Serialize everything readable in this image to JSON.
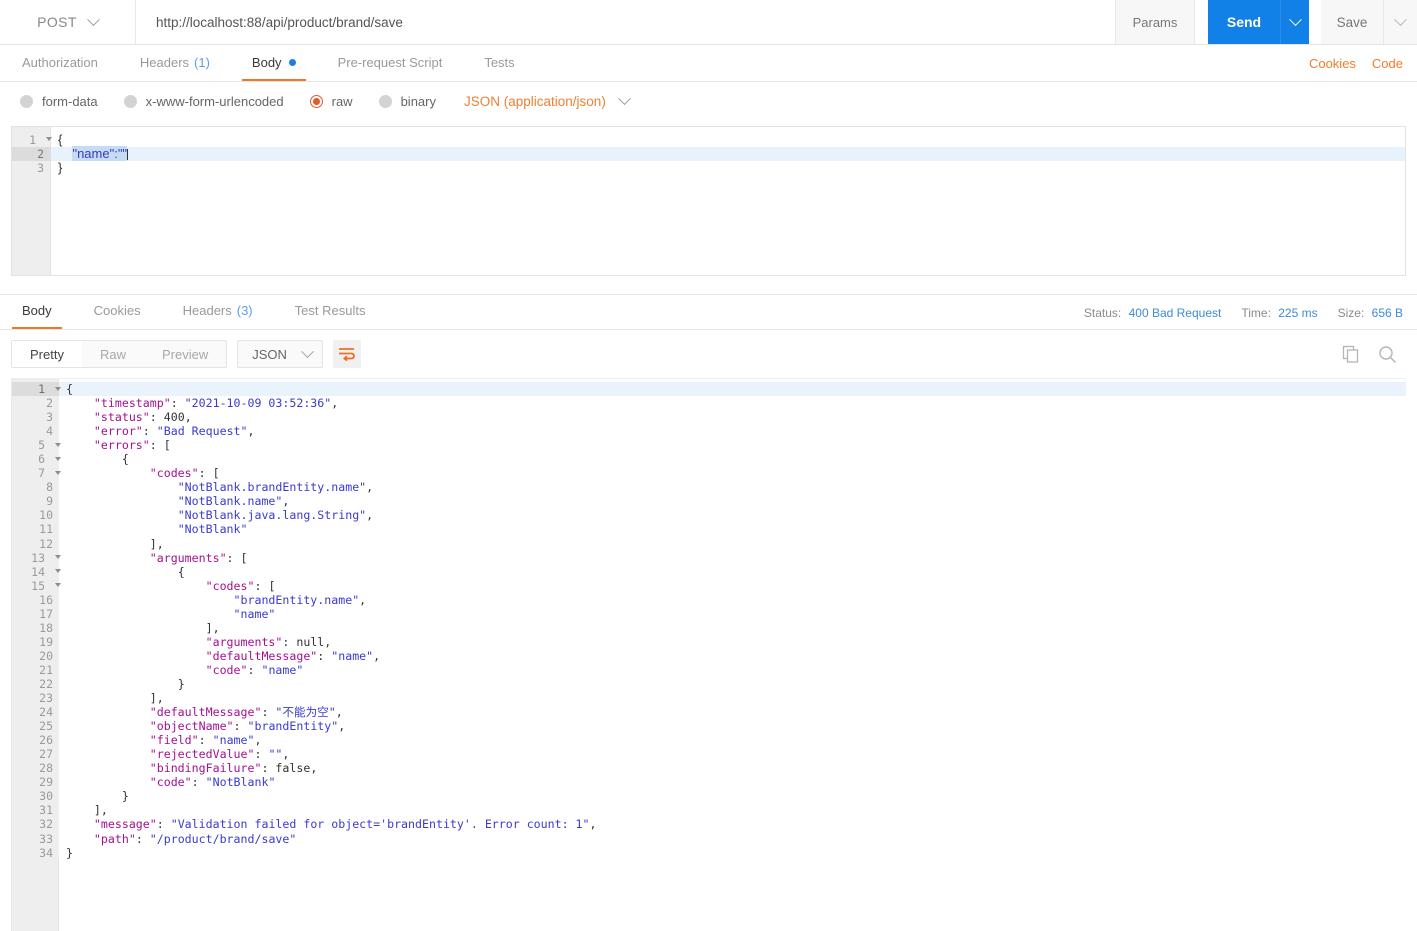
{
  "urlbar": {
    "method": "POST",
    "url": "http://localhost:88/api/product/brand/save",
    "params_label": "Params",
    "send_label": "Send",
    "save_label": "Save"
  },
  "request_tabs": [
    {
      "label": "Authorization",
      "count": "",
      "active": false,
      "dot": false
    },
    {
      "label": "Headers",
      "count": "(1)",
      "active": false,
      "dot": false
    },
    {
      "label": "Body",
      "count": "",
      "active": true,
      "dot": true
    },
    {
      "label": "Pre-request Script",
      "count": "",
      "active": false,
      "dot": false
    },
    {
      "label": "Tests",
      "count": "",
      "active": false,
      "dot": false
    }
  ],
  "tabs_right": {
    "cookies": "Cookies",
    "code": "Code"
  },
  "body_type": {
    "options": [
      {
        "label": "form-data",
        "checked": false
      },
      {
        "label": "x-www-form-urlencoded",
        "checked": false
      },
      {
        "label": "raw",
        "checked": true
      },
      {
        "label": "binary",
        "checked": false
      }
    ],
    "format": "JSON (application/json)"
  },
  "request_body": {
    "lines": [
      {
        "num": "1",
        "fold": true,
        "selected": false,
        "text": "{"
      },
      {
        "num": "2",
        "fold": false,
        "selected": true,
        "text": "    \"name\":\"\""
      },
      {
        "num": "3",
        "fold": false,
        "selected": false,
        "text": "}"
      }
    ],
    "selected_text": "\"name\":\"\""
  },
  "response_tabs": [
    {
      "label": "Body",
      "count": "",
      "active": true
    },
    {
      "label": "Cookies",
      "count": "",
      "active": false
    },
    {
      "label": "Headers",
      "count": "(3)",
      "active": false
    },
    {
      "label": "Test Results",
      "count": "",
      "active": false
    }
  ],
  "response_status": {
    "status_label": "Status:",
    "status_value": "400 Bad Request",
    "time_label": "Time:",
    "time_value": "225 ms",
    "size_label": "Size:",
    "size_value": "656 B"
  },
  "response_toolbar": {
    "views": [
      {
        "label": "Pretty",
        "active": true
      },
      {
        "label": "Raw",
        "active": false
      },
      {
        "label": "Preview",
        "active": false
      }
    ],
    "format": "JSON",
    "wrap_icon": "word-wrap-icon",
    "copy_icon": "copy-icon",
    "search_icon": "search-icon"
  },
  "response_body": {
    "language": "json",
    "lines": [
      {
        "num": "1",
        "fold": true,
        "active": true,
        "indent": 0,
        "tokens": [
          {
            "t": "p",
            "v": "{"
          }
        ]
      },
      {
        "num": "2",
        "fold": false,
        "active": false,
        "indent": 1,
        "tokens": [
          {
            "t": "k",
            "v": "\"timestamp\""
          },
          {
            "t": "p",
            "v": ": "
          },
          {
            "t": "s",
            "v": "\"2021-10-09 03:52:36\""
          },
          {
            "t": "p",
            "v": ","
          }
        ]
      },
      {
        "num": "3",
        "fold": false,
        "active": false,
        "indent": 1,
        "tokens": [
          {
            "t": "k",
            "v": "\"status\""
          },
          {
            "t": "p",
            "v": ": "
          },
          {
            "t": "n",
            "v": "400"
          },
          {
            "t": "p",
            "v": ","
          }
        ]
      },
      {
        "num": "4",
        "fold": false,
        "active": false,
        "indent": 1,
        "tokens": [
          {
            "t": "k",
            "v": "\"error\""
          },
          {
            "t": "p",
            "v": ": "
          },
          {
            "t": "s",
            "v": "\"Bad Request\""
          },
          {
            "t": "p",
            "v": ","
          }
        ]
      },
      {
        "num": "5",
        "fold": true,
        "active": false,
        "indent": 1,
        "tokens": [
          {
            "t": "k",
            "v": "\"errors\""
          },
          {
            "t": "p",
            "v": ": ["
          }
        ]
      },
      {
        "num": "6",
        "fold": true,
        "active": false,
        "indent": 2,
        "tokens": [
          {
            "t": "p",
            "v": "{"
          }
        ]
      },
      {
        "num": "7",
        "fold": true,
        "active": false,
        "indent": 3,
        "tokens": [
          {
            "t": "k",
            "v": "\"codes\""
          },
          {
            "t": "p",
            "v": ": ["
          }
        ]
      },
      {
        "num": "8",
        "fold": false,
        "active": false,
        "indent": 4,
        "tokens": [
          {
            "t": "s",
            "v": "\"NotBlank.brandEntity.name\""
          },
          {
            "t": "p",
            "v": ","
          }
        ]
      },
      {
        "num": "9",
        "fold": false,
        "active": false,
        "indent": 4,
        "tokens": [
          {
            "t": "s",
            "v": "\"NotBlank.name\""
          },
          {
            "t": "p",
            "v": ","
          }
        ]
      },
      {
        "num": "10",
        "fold": false,
        "active": false,
        "indent": 4,
        "tokens": [
          {
            "t": "s",
            "v": "\"NotBlank.java.lang.String\""
          },
          {
            "t": "p",
            "v": ","
          }
        ]
      },
      {
        "num": "11",
        "fold": false,
        "active": false,
        "indent": 4,
        "tokens": [
          {
            "t": "s",
            "v": "\"NotBlank\""
          }
        ]
      },
      {
        "num": "12",
        "fold": false,
        "active": false,
        "indent": 3,
        "tokens": [
          {
            "t": "p",
            "v": "],"
          }
        ]
      },
      {
        "num": "13",
        "fold": true,
        "active": false,
        "indent": 3,
        "tokens": [
          {
            "t": "k",
            "v": "\"arguments\""
          },
          {
            "t": "p",
            "v": ": ["
          }
        ]
      },
      {
        "num": "14",
        "fold": true,
        "active": false,
        "indent": 4,
        "tokens": [
          {
            "t": "p",
            "v": "{"
          }
        ]
      },
      {
        "num": "15",
        "fold": true,
        "active": false,
        "indent": 5,
        "tokens": [
          {
            "t": "k",
            "v": "\"codes\""
          },
          {
            "t": "p",
            "v": ": ["
          }
        ]
      },
      {
        "num": "16",
        "fold": false,
        "active": false,
        "indent": 6,
        "tokens": [
          {
            "t": "s",
            "v": "\"brandEntity.name\""
          },
          {
            "t": "p",
            "v": ","
          }
        ]
      },
      {
        "num": "17",
        "fold": false,
        "active": false,
        "indent": 6,
        "tokens": [
          {
            "t": "s",
            "v": "\"name\""
          }
        ]
      },
      {
        "num": "18",
        "fold": false,
        "active": false,
        "indent": 5,
        "tokens": [
          {
            "t": "p",
            "v": "],"
          }
        ]
      },
      {
        "num": "19",
        "fold": false,
        "active": false,
        "indent": 5,
        "tokens": [
          {
            "t": "k",
            "v": "\"arguments\""
          },
          {
            "t": "p",
            "v": ": "
          },
          {
            "t": "n",
            "v": "null"
          },
          {
            "t": "p",
            "v": ","
          }
        ]
      },
      {
        "num": "20",
        "fold": false,
        "active": false,
        "indent": 5,
        "tokens": [
          {
            "t": "k",
            "v": "\"defaultMessage\""
          },
          {
            "t": "p",
            "v": ": "
          },
          {
            "t": "s",
            "v": "\"name\""
          },
          {
            "t": "p",
            "v": ","
          }
        ]
      },
      {
        "num": "21",
        "fold": false,
        "active": false,
        "indent": 5,
        "tokens": [
          {
            "t": "k",
            "v": "\"code\""
          },
          {
            "t": "p",
            "v": ": "
          },
          {
            "t": "s",
            "v": "\"name\""
          }
        ]
      },
      {
        "num": "22",
        "fold": false,
        "active": false,
        "indent": 4,
        "tokens": [
          {
            "t": "p",
            "v": "}"
          }
        ]
      },
      {
        "num": "23",
        "fold": false,
        "active": false,
        "indent": 3,
        "tokens": [
          {
            "t": "p",
            "v": "],"
          }
        ]
      },
      {
        "num": "24",
        "fold": false,
        "active": false,
        "indent": 3,
        "tokens": [
          {
            "t": "k",
            "v": "\"defaultMessage\""
          },
          {
            "t": "p",
            "v": ": "
          },
          {
            "t": "s",
            "v": "\"不能为空\""
          },
          {
            "t": "p",
            "v": ","
          }
        ]
      },
      {
        "num": "25",
        "fold": false,
        "active": false,
        "indent": 3,
        "tokens": [
          {
            "t": "k",
            "v": "\"objectName\""
          },
          {
            "t": "p",
            "v": ": "
          },
          {
            "t": "s",
            "v": "\"brandEntity\""
          },
          {
            "t": "p",
            "v": ","
          }
        ]
      },
      {
        "num": "26",
        "fold": false,
        "active": false,
        "indent": 3,
        "tokens": [
          {
            "t": "k",
            "v": "\"field\""
          },
          {
            "t": "p",
            "v": ": "
          },
          {
            "t": "s",
            "v": "\"name\""
          },
          {
            "t": "p",
            "v": ","
          }
        ]
      },
      {
        "num": "27",
        "fold": false,
        "active": false,
        "indent": 3,
        "tokens": [
          {
            "t": "k",
            "v": "\"rejectedValue\""
          },
          {
            "t": "p",
            "v": ": "
          },
          {
            "t": "s",
            "v": "\"\""
          },
          {
            "t": "p",
            "v": ","
          }
        ]
      },
      {
        "num": "28",
        "fold": false,
        "active": false,
        "indent": 3,
        "tokens": [
          {
            "t": "k",
            "v": "\"bindingFailure\""
          },
          {
            "t": "p",
            "v": ": "
          },
          {
            "t": "n",
            "v": "false"
          },
          {
            "t": "p",
            "v": ","
          }
        ]
      },
      {
        "num": "29",
        "fold": false,
        "active": false,
        "indent": 3,
        "tokens": [
          {
            "t": "k",
            "v": "\"code\""
          },
          {
            "t": "p",
            "v": ": "
          },
          {
            "t": "s",
            "v": "\"NotBlank\""
          }
        ]
      },
      {
        "num": "30",
        "fold": false,
        "active": false,
        "indent": 2,
        "tokens": [
          {
            "t": "p",
            "v": "}"
          }
        ]
      },
      {
        "num": "31",
        "fold": false,
        "active": false,
        "indent": 1,
        "tokens": [
          {
            "t": "p",
            "v": "],"
          }
        ]
      },
      {
        "num": "32",
        "fold": false,
        "active": false,
        "indent": 1,
        "tokens": [
          {
            "t": "k",
            "v": "\"message\""
          },
          {
            "t": "p",
            "v": ": "
          },
          {
            "t": "s",
            "v": "\"Validation failed for object='brandEntity'. Error count: 1\""
          },
          {
            "t": "p",
            "v": ","
          }
        ]
      },
      {
        "num": "33",
        "fold": false,
        "active": false,
        "indent": 1,
        "tokens": [
          {
            "t": "k",
            "v": "\"path\""
          },
          {
            "t": "p",
            "v": ": "
          },
          {
            "t": "s",
            "v": "\"/product/brand/save\""
          }
        ]
      },
      {
        "num": "34",
        "fold": false,
        "active": false,
        "indent": 0,
        "tokens": [
          {
            "t": "p",
            "v": "}"
          }
        ]
      }
    ]
  },
  "colors": {
    "accent_orange": "#ef7623",
    "accent_blue": "#1180e7",
    "link_blue": "#3b8cd8",
    "json_key": "#a3118f",
    "json_string": "#3a3ad0"
  }
}
